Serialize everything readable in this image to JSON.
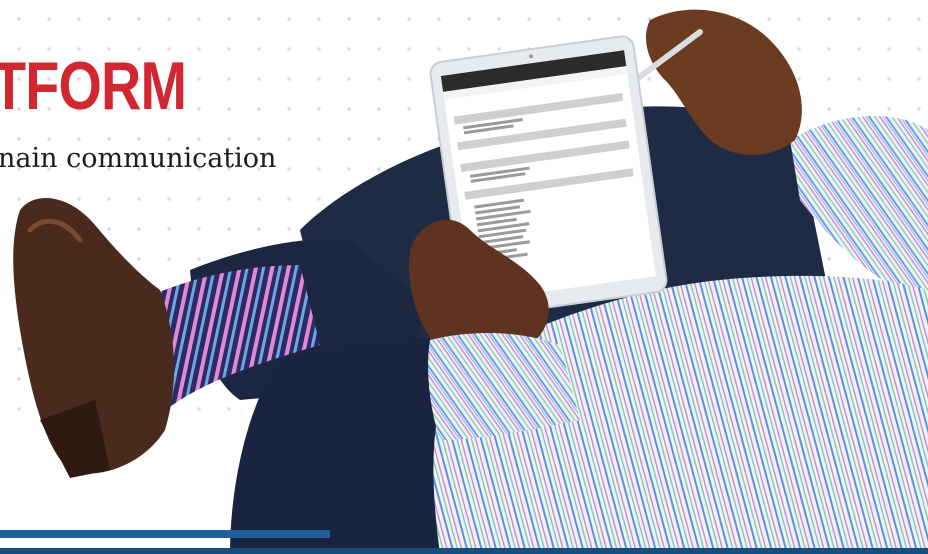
{
  "headline": "TFORM",
  "subheadline": "nain communication",
  "colors": {
    "accent_red": "#d22630",
    "brand_blue": "#164e7e",
    "sock_purple": "#3a2f6e",
    "suit_navy": "#1f2a44",
    "shoe_brown": "#4a2a1c",
    "shirt_base": "#eef1f8"
  },
  "tablet": {
    "sections": [
      "",
      "",
      "",
      ""
    ]
  }
}
